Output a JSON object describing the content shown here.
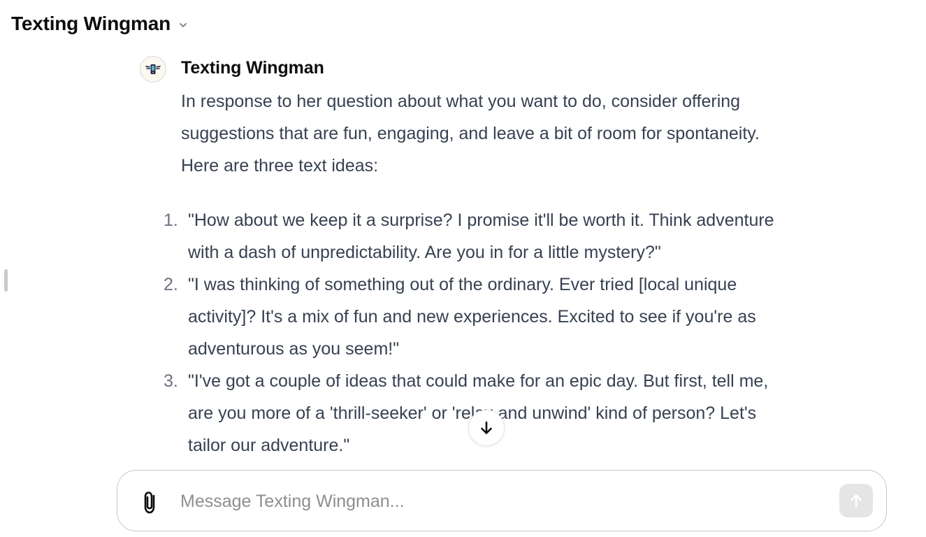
{
  "header": {
    "title": "Texting Wingman"
  },
  "message": {
    "author": "Texting Wingman",
    "intro": "In response to her question about what you want to do, consider offering suggestions that are fun, engaging, and leave a bit of room for spontaneity. Here are three text ideas:",
    "ideas": [
      {
        "number": "1.",
        "text": "\"How about we keep it a surprise? I promise it'll be worth it. Think adventure with a dash of unpredictability. Are you in for a little mystery?\""
      },
      {
        "number": "2.",
        "text": "\"I was thinking of something out of the ordinary. Ever tried [local unique activity]? It's a mix of fun and new experiences. Excited to see if you're as adventurous as you seem!\""
      },
      {
        "number": "3.",
        "text": "\"I've got a couple of ideas that could make for an epic day. But first, tell me, are you more of a 'thrill-seeker' or 'relax and unwind' kind of person? Let's tailor our adventure.\""
      }
    ]
  },
  "composer": {
    "placeholder": "Message Texting Wingman...",
    "value": ""
  },
  "icons": {
    "header_dropdown": "chevron-down-icon",
    "avatar": "wingman-logo",
    "scroll": "arrow-down-icon",
    "attach": "paperclip-icon",
    "send": "arrow-up-icon"
  },
  "colors": {
    "text_primary": "#0d0d0d",
    "text_body": "#374151",
    "placeholder": "#8e8e8e",
    "send_disabled_bg": "#e5e5e5"
  }
}
